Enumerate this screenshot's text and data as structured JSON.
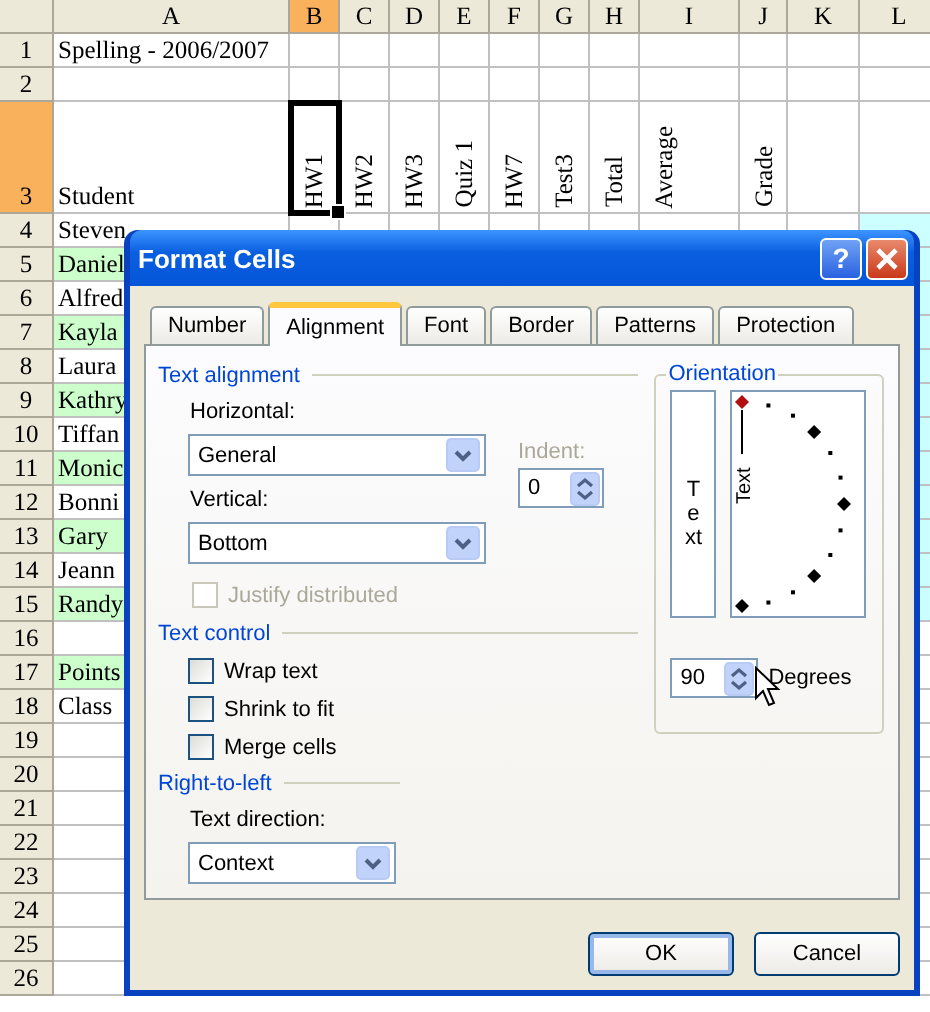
{
  "spreadsheet": {
    "columns": [
      {
        "label": "A",
        "selected": false
      },
      {
        "label": "B",
        "selected": true
      },
      {
        "label": "C",
        "selected": false
      },
      {
        "label": "D",
        "selected": false
      },
      {
        "label": "E",
        "selected": false
      },
      {
        "label": "F",
        "selected": false
      },
      {
        "label": "G",
        "selected": false
      },
      {
        "label": "H",
        "selected": false
      },
      {
        "label": "I",
        "selected": false
      },
      {
        "label": "J",
        "selected": false
      },
      {
        "label": "K",
        "selected": false
      },
      {
        "label": "L",
        "selected": false
      }
    ],
    "rows": [
      {
        "label": "1",
        "selected": false,
        "cells": {
          "A": {
            "text": "Spelling - 2006/2007",
            "rotated": false,
            "active": false
          }
        }
      },
      {
        "label": "2",
        "selected": false
      },
      {
        "label": "3",
        "selected": true,
        "cells": {
          "A": {
            "text": "Student",
            "rotated": false,
            "active": false
          },
          "B": {
            "text": "HW1",
            "rotated": true,
            "active": true
          },
          "C": {
            "text": "HW2",
            "rotated": true,
            "active": false
          },
          "D": {
            "text": "HW3",
            "rotated": true,
            "active": false
          },
          "E": {
            "text": "Quiz 1",
            "rotated": true,
            "active": false
          },
          "F": {
            "text": "HW7",
            "rotated": true,
            "active": false
          },
          "G": {
            "text": "Test3",
            "rotated": true,
            "active": false
          },
          "H": {
            "text": "Total",
            "rotated": true,
            "active": false
          },
          "I": {
            "text": "Average",
            "rotated": true,
            "active": false
          },
          "J": {
            "text": "Grade",
            "rotated": true,
            "active": false
          }
        }
      },
      {
        "label": "4",
        "selected": false,
        "highlighted": false,
        "column_l_filled": true,
        "cells": {
          "A": {
            "text": "Steven",
            "rotated": false,
            "active": false
          }
        }
      },
      {
        "label": "5",
        "selected": false,
        "highlighted": true,
        "column_l_filled": true,
        "cells": {
          "A": {
            "text": "Daniel",
            "rotated": false,
            "active": false
          }
        }
      },
      {
        "label": "6",
        "selected": false,
        "highlighted": false,
        "column_l_filled": true,
        "cells": {
          "A": {
            "text": "Alfred",
            "rotated": false,
            "active": false
          }
        }
      },
      {
        "label": "7",
        "selected": false,
        "highlighted": true,
        "column_l_filled": true,
        "cells": {
          "A": {
            "text": "Kayla",
            "rotated": false,
            "active": false
          }
        }
      },
      {
        "label": "8",
        "selected": false,
        "highlighted": false,
        "column_l_filled": true,
        "cells": {
          "A": {
            "text": "Laura",
            "rotated": false,
            "active": false
          }
        }
      },
      {
        "label": "9",
        "selected": false,
        "highlighted": true,
        "column_l_filled": true,
        "cells": {
          "A": {
            "text": "Kathry",
            "rotated": false,
            "active": false
          }
        }
      },
      {
        "label": "10",
        "selected": false,
        "highlighted": false,
        "column_l_filled": true,
        "cells": {
          "A": {
            "text": "Tiffan",
            "rotated": false,
            "active": false
          }
        }
      },
      {
        "label": "11",
        "selected": false,
        "highlighted": true,
        "column_l_filled": true,
        "cells": {
          "A": {
            "text": "Monic",
            "rotated": false,
            "active": false
          }
        }
      },
      {
        "label": "12",
        "selected": false,
        "highlighted": false,
        "column_l_filled": true,
        "cells": {
          "A": {
            "text": "Bonni",
            "rotated": false,
            "active": false
          }
        }
      },
      {
        "label": "13",
        "selected": false,
        "highlighted": true,
        "column_l_filled": true,
        "cells": {
          "A": {
            "text": "Gary",
            "rotated": false,
            "active": false
          }
        }
      },
      {
        "label": "14",
        "selected": false,
        "highlighted": false,
        "column_l_filled": true,
        "cells": {
          "A": {
            "text": "Jeann",
            "rotated": false,
            "active": false
          }
        }
      },
      {
        "label": "15",
        "selected": false,
        "highlighted": true,
        "column_l_filled": true,
        "cells": {
          "A": {
            "text": "Randy",
            "rotated": false,
            "active": false
          }
        }
      },
      {
        "label": "16",
        "selected": false
      },
      {
        "label": "17",
        "selected": false,
        "highlighted": true,
        "cells": {
          "A": {
            "text": "Points",
            "rotated": false,
            "active": false
          }
        }
      },
      {
        "label": "18",
        "selected": false,
        "cells": {
          "A": {
            "text": "Class",
            "rotated": false,
            "active": false
          }
        }
      },
      {
        "label": "19",
        "selected": false
      },
      {
        "label": "20",
        "selected": false
      },
      {
        "label": "21",
        "selected": false
      },
      {
        "label": "22",
        "selected": false
      },
      {
        "label": "23",
        "selected": false
      },
      {
        "label": "24",
        "selected": false
      },
      {
        "label": "25",
        "selected": false
      },
      {
        "label": "26",
        "selected": false
      }
    ]
  },
  "dialog": {
    "title": "Format Cells",
    "help_button": "?",
    "tabs": [
      {
        "label": "Number",
        "selected": false
      },
      {
        "label": "Alignment",
        "selected": true
      },
      {
        "label": "Font",
        "selected": false
      },
      {
        "label": "Border",
        "selected": false
      },
      {
        "label": "Patterns",
        "selected": false
      },
      {
        "label": "Protection",
        "selected": false
      }
    ],
    "text_alignment": {
      "title": "Text alignment",
      "horizontal": {
        "label": "Horizontal:",
        "value": "General"
      },
      "vertical": {
        "label": "Vertical:",
        "value": "Bottom"
      },
      "indent": {
        "label": "Indent:",
        "value": "0",
        "disabled": true
      },
      "justify_distributed": {
        "label": "Justify distributed",
        "checked": false,
        "disabled": true
      }
    },
    "text_control": {
      "title": "Text control",
      "options": [
        {
          "label": "Wrap text",
          "checked": false
        },
        {
          "label": "Shrink to fit",
          "checked": false
        },
        {
          "label": "Merge cells",
          "checked": false
        }
      ]
    },
    "right_to_left": {
      "title": "Right-to-left",
      "text_direction": {
        "label": "Text direction:",
        "value": "Context"
      }
    },
    "orientation": {
      "title": "Orientation",
      "vertical_text": "Text",
      "dial_text": "Text",
      "degrees": {
        "value": "90",
        "label": "Degrees"
      }
    },
    "buttons": [
      {
        "label": "OK",
        "default": true
      },
      {
        "label": "Cancel",
        "default": false
      }
    ]
  }
}
